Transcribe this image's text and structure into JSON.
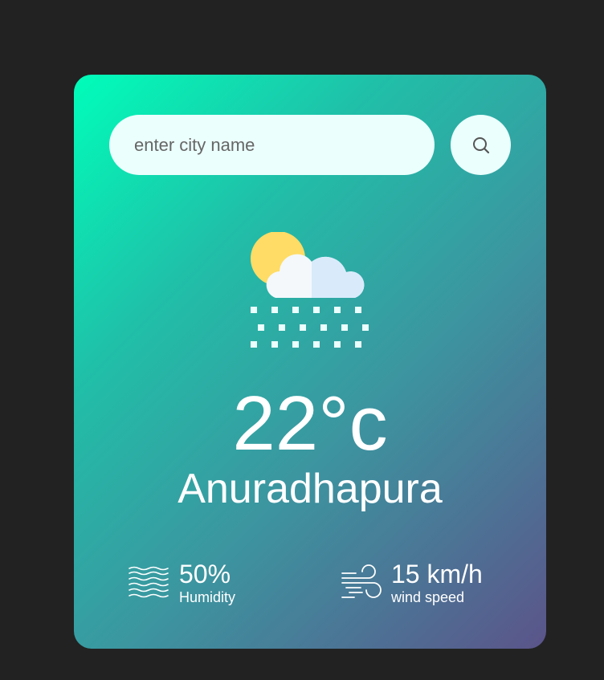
{
  "search": {
    "placeholder": "enter city name",
    "button_icon": "search-icon"
  },
  "weather": {
    "icon": "snow-cloud-sun-icon",
    "temperature": "22°c",
    "city": "Anuradhapura"
  },
  "details": {
    "humidity": {
      "icon": "humidity-waves-icon",
      "value": "50%",
      "label": "Humidity"
    },
    "wind": {
      "icon": "wind-icon",
      "value": "15 km/h",
      "label": "wind speed"
    }
  },
  "colors": {
    "page_background": "#222222",
    "gradient_start": "#00feba",
    "gradient_end": "#5b548a",
    "input_background": "#ebfffc",
    "text": "#ffffff"
  }
}
